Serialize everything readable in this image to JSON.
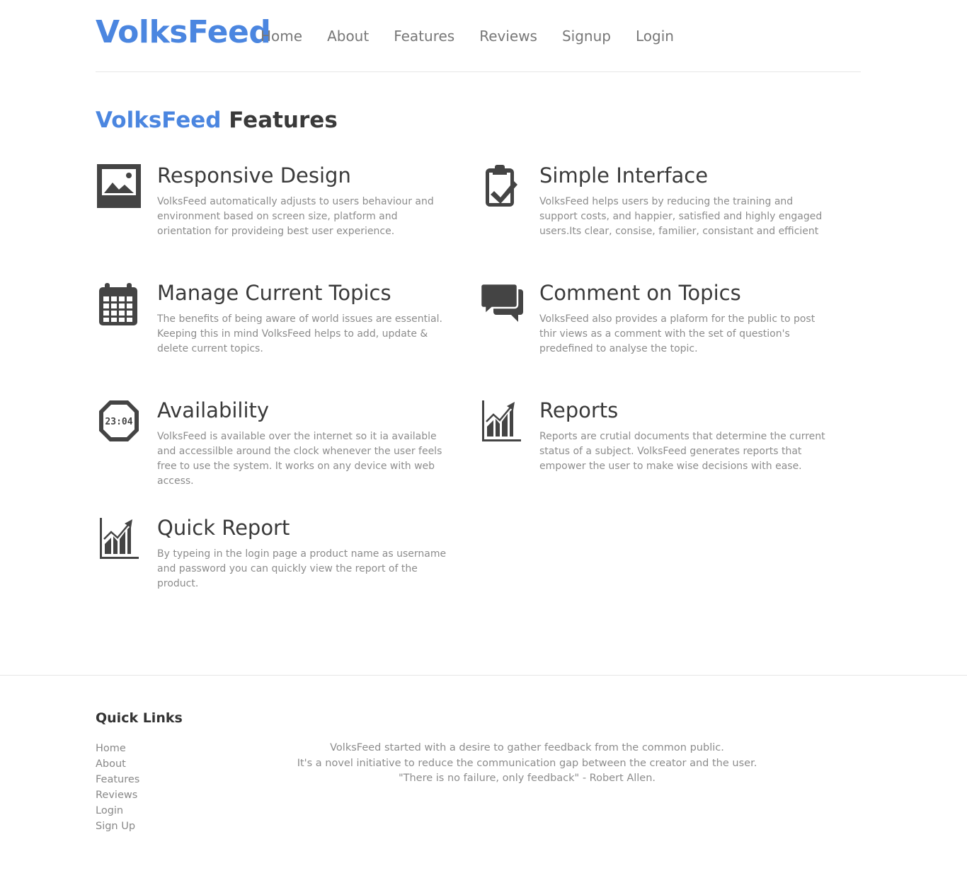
{
  "header": {
    "brand": "VolksFeed",
    "nav": [
      {
        "label": "Home"
      },
      {
        "label": "About"
      },
      {
        "label": "Features"
      },
      {
        "label": "Reviews"
      },
      {
        "label": "Signup"
      },
      {
        "label": "Login"
      }
    ]
  },
  "features_section": {
    "title_accent": "VolksFeed",
    "title_rest": "Features",
    "items": [
      {
        "icon": "image-icon",
        "title": "Responsive Design",
        "text": "VolksFeed automatically adjusts to users behaviour and environment based on screen size, platform and orientation for provideing best user experience."
      },
      {
        "icon": "clipboard-check-icon",
        "title": "Simple Interface",
        "text": "VolksFeed helps users by reducing the training and support costs, and happier, satisfied and highly engaged users.Its clear, consise, familier, consistant and efficient"
      },
      {
        "icon": "calendar-icon",
        "title": "Manage Current Topics",
        "text": "The benefits of being aware of world issues are essential. Keeping this in mind VolksFeed helps to add, update & delete current topics."
      },
      {
        "icon": "chat-bubbles-icon",
        "title": "Comment on Topics",
        "text": "VolksFeed also provides a plaform for the public to post thir views as a comment with the set of question's predefined to analyse the topic."
      },
      {
        "icon": "watch-icon",
        "title": "Availability",
        "text": "VolksFeed is available over the internet so it ia available and accessilble around the clock whenever the user feels free to use the system. It works on any device with web access.",
        "icon_text": "23:04"
      },
      {
        "icon": "chart-icon",
        "title": "Reports",
        "text": "Reports are crutial documents that determine the current status of a subject. VolksFeed generates reports that empower the user to make wise decisions with ease."
      },
      {
        "icon": "chart-icon",
        "title": "Quick Report",
        "text": "By typeing in the login page a product name as username and password you can quickly view the report of the product."
      }
    ]
  },
  "footer": {
    "quick_links_title": "Quick Links",
    "links": [
      "Home",
      "About",
      "Features",
      "Reviews",
      "Login",
      "Sign Up"
    ],
    "about_lines": [
      "VolksFeed started with a desire to gather feedback from the common public.",
      "It's a novel initiative to reduce the communication gap between the creator and the user.",
      "\"There is no failure, only feedback\" - Robert Allen."
    ]
  },
  "colors": {
    "accent": "#4b86e0",
    "icon": "#444444",
    "text_muted": "#8c8c8c"
  }
}
